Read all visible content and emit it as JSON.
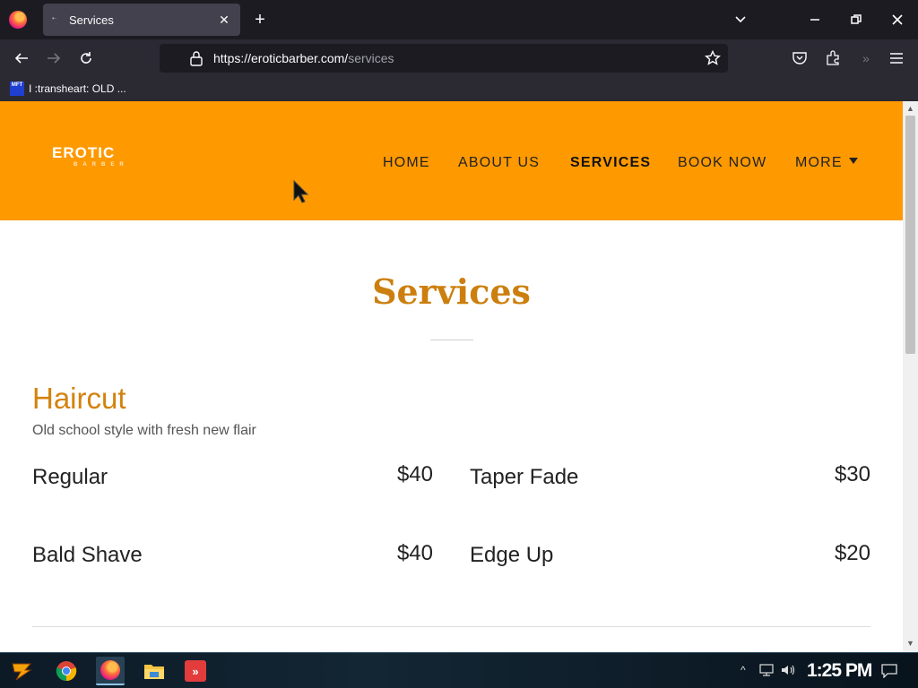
{
  "browser": {
    "tab": {
      "title": "Services"
    },
    "url": {
      "domain": "https://eroticbarber.com/",
      "path": "services"
    },
    "bookmark": {
      "label": "I :transheart: OLD ...",
      "icon_text": "MFT"
    }
  },
  "site": {
    "logo": {
      "text": "EROTIC",
      "subtext": "BARBER"
    },
    "nav": {
      "home": "HOME",
      "about": "ABOUT US",
      "services": "SERVICES",
      "book": "BOOK NOW",
      "more": "MORE"
    },
    "page_title": "Services",
    "section": {
      "title": "Haircut",
      "subtitle": "Old school style with fresh new flair",
      "items": [
        {
          "name": "Regular",
          "price": "$40"
        },
        {
          "name": "Taper Fade",
          "price": "$30"
        },
        {
          "name": "Bald Shave",
          "price": "$40"
        },
        {
          "name": "Edge Up",
          "price": "$20"
        }
      ]
    }
  },
  "taskbar": {
    "time": "1:25 PM"
  },
  "colors": {
    "accent": "#ff9900",
    "heading": "#cc7f0e"
  }
}
